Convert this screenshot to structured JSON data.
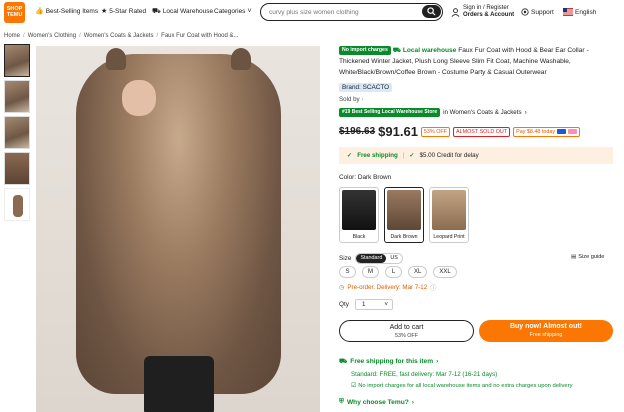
{
  "header": {
    "logo_line1": "SHOP",
    "logo_line2": "TEMU",
    "nav": [
      {
        "label": "Best-Selling Items",
        "icon": "thumbs-up-icon"
      },
      {
        "label": "5-Star Rated",
        "icon": "star-icon"
      },
      {
        "label": "Local Warehouse",
        "icon": "truck-icon"
      },
      {
        "label": "Categories",
        "icon": "chevron-down-icon"
      }
    ],
    "search_placeholder": "curvy plus size women clothing",
    "account_line1": "Sign in / Register",
    "account_line2": "Orders & Account",
    "support": "Support",
    "language": "English"
  },
  "breadcrumb": [
    "Home",
    "Women's Clothing",
    "Women's Coats & Jackets",
    "Faux Fur Coat with Hood &..."
  ],
  "product": {
    "badge": "No import charges",
    "local_warehouse": "Local warehouse",
    "title": "Faux Fur Coat with Hood & Bear Ear Collar - Thickened Winter Jacket, Plush Long Sleeve Slim Fit Coat, Machine Washable, White/Black/Brown/Coffee Brown - Costume Party & Casual Outerwear",
    "brand": "Brand: SCACTO",
    "sold_by": "Sold by",
    "rank_badge": "#19 Best Selling Local Warehouse Store",
    "rank_category": "in Women's Coats & Jackets",
    "old_price": "$196.63",
    "new_price": "$91.61",
    "discount": "53% OFF",
    "almost_sold_out": "ALMOST SOLD OUT",
    "pay_later": "Pay $8.48 today",
    "shipping": "Free shipping",
    "credit": "$5.00 Credit for delay",
    "color_label": "Color: Dark Brown",
    "colors": [
      {
        "name": "Black",
        "swatch": "#1a1a1a"
      },
      {
        "name": "Dark Brown",
        "swatch": "#7a5d47"
      },
      {
        "name": "Leopard Print",
        "swatch": "#a88a6a"
      }
    ],
    "size_label": "Size",
    "size_std": "Standard",
    "size_us": "US",
    "size_guide": "Size guide",
    "sizes": [
      "S",
      "M",
      "L",
      "XL",
      "XXL"
    ],
    "preorder": "Pre-order. Delivery: Mar 7-12",
    "qty_label": "Qty",
    "qty_value": "1",
    "add_cart": "Add to cart",
    "add_cart_sub": "53% OFF",
    "buy_now": "Buy now! Almost out!",
    "buy_now_sub": "Free shipping",
    "free_item": "Free shipping for this item",
    "standard": "Standard: FREE, fast delivery: Mar 7-12 (16-21 days)",
    "no_import": "No import charges for all local warehouse items and no extra charges upon delivery",
    "why": "Why choose Temu?"
  },
  "colors": {
    "accent": "#fb7701",
    "green": "#0a8a2a",
    "dark": "#222222"
  }
}
